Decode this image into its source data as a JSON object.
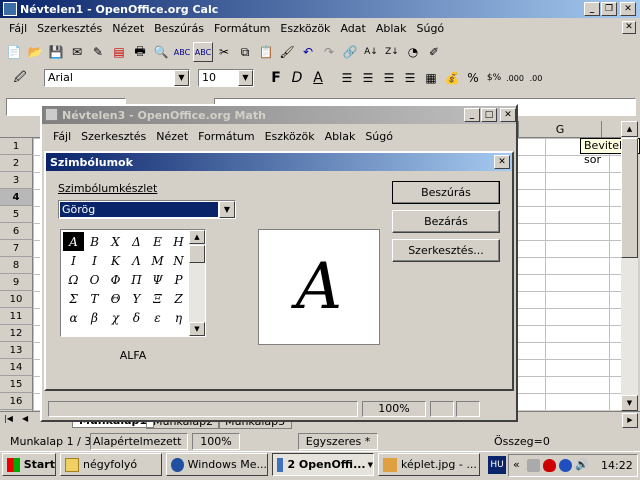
{
  "calc": {
    "title": "Névtelen1 - OpenOffice.org Calc",
    "menu": [
      "Fájl",
      "Szerkesztés",
      "Nézet",
      "Beszúrás",
      "Formátum",
      "Eszközök",
      "Adat",
      "Ablak",
      "Súgó"
    ],
    "font_name": "Arial",
    "font_size": "10",
    "column_g": "G",
    "tooltip": "Beviteli sor",
    "rows": [
      "1",
      "2",
      "3",
      "4",
      "5",
      "6",
      "7",
      "8",
      "9",
      "10",
      "11",
      "12",
      "13",
      "14",
      "15",
      "16",
      "17"
    ],
    "sheet_tabs": [
      "Munkalap1",
      "Munkalap2",
      "Munkalap3"
    ],
    "status": {
      "sheet": "Munkalap 1 / 3",
      "style": "Alapértelmezett",
      "zoom": "100%",
      "mode": "Egyszeres *",
      "sum": "Összeg=0"
    }
  },
  "math": {
    "title": "Névtelen3 - OpenOffice.org Math",
    "menu": [
      "Fájl",
      "Szerkesztés",
      "Nézet",
      "Formátum",
      "Eszközök",
      "Ablak",
      "Súgó"
    ],
    "zoom": "100%"
  },
  "dialog": {
    "title": "Szimbólumok",
    "set_label": "Szimbólumkészlet",
    "set_value": "Görög",
    "symbols": [
      [
        "Α",
        "Β",
        "Χ",
        "Δ",
        "Ε",
        "Η"
      ],
      [
        "Ι",
        "Ι",
        "Κ",
        "Λ",
        "Μ",
        "Ν"
      ],
      [
        "Ω",
        "Ο",
        "Φ",
        "Π",
        "Ψ",
        "Ρ"
      ],
      [
        "Σ",
        "Τ",
        "Θ",
        "Υ",
        "Ξ",
        "Ζ"
      ],
      [
        "α",
        "β",
        "χ",
        "δ",
        "ε",
        "η"
      ]
    ],
    "preview_symbol": "A",
    "symbol_name": "ALFA",
    "buttons": {
      "insert": "Beszúrás",
      "close": "Bezárás",
      "edit": "Szerkesztés..."
    }
  },
  "taskbar": {
    "start": "Start",
    "items": [
      "négyfolyó",
      "Windows Me...",
      "2 OpenOffi...",
      "képlet.jpg - ..."
    ],
    "lang": "HU",
    "clock": "14:22"
  }
}
